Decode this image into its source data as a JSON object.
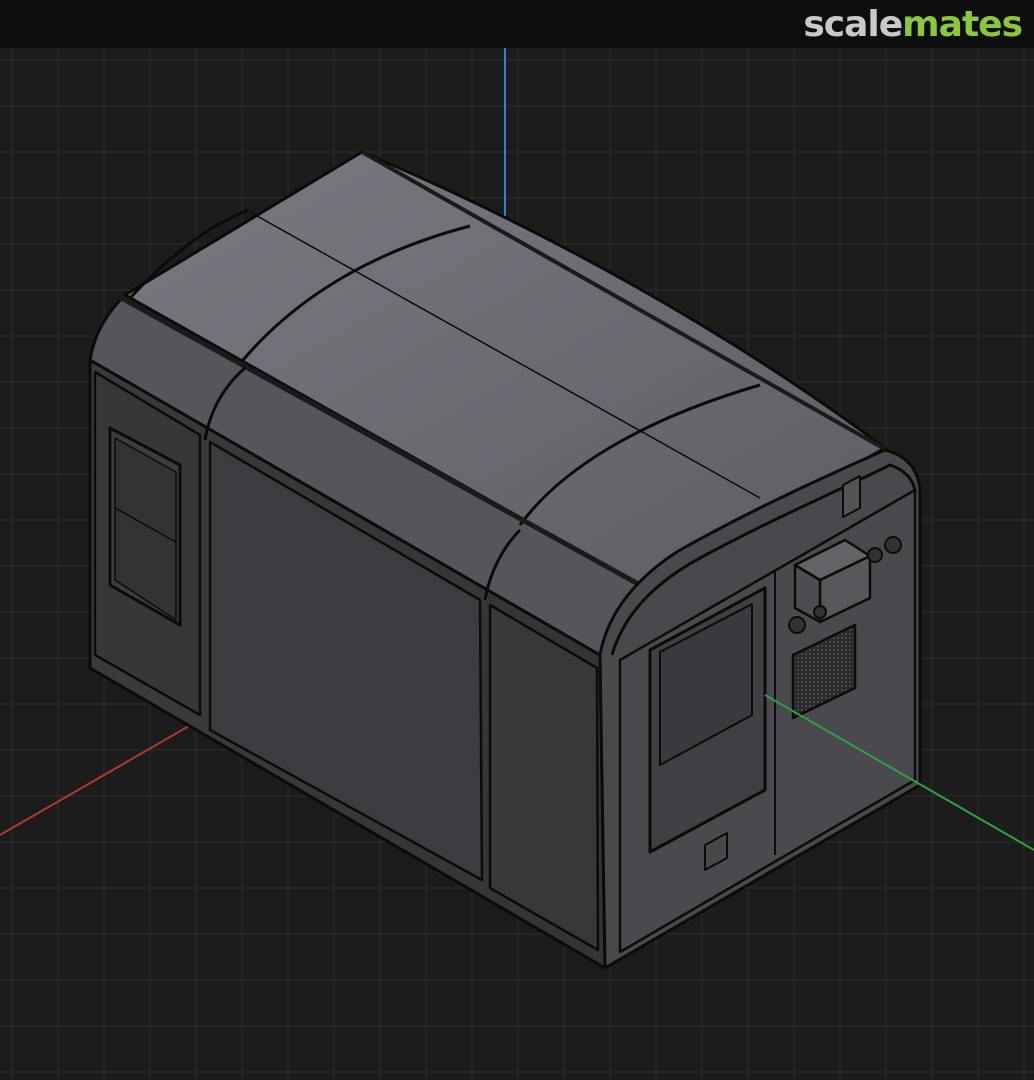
{
  "logo": {
    "part1": "scale",
    "part2": "mates"
  },
  "colors": {
    "background": "#1c1c1c",
    "grid": "#333333",
    "axis_x": "#c0392b",
    "axis_y": "#2ea043",
    "axis_z": "#3a7bd5",
    "body_face": "#3a3a3d",
    "front_face": "#4a4a4e",
    "roof": "#6b6b72",
    "outline": "#0a0a0a"
  },
  "icons": [
    "grid-floor",
    "axis-gizmo"
  ]
}
